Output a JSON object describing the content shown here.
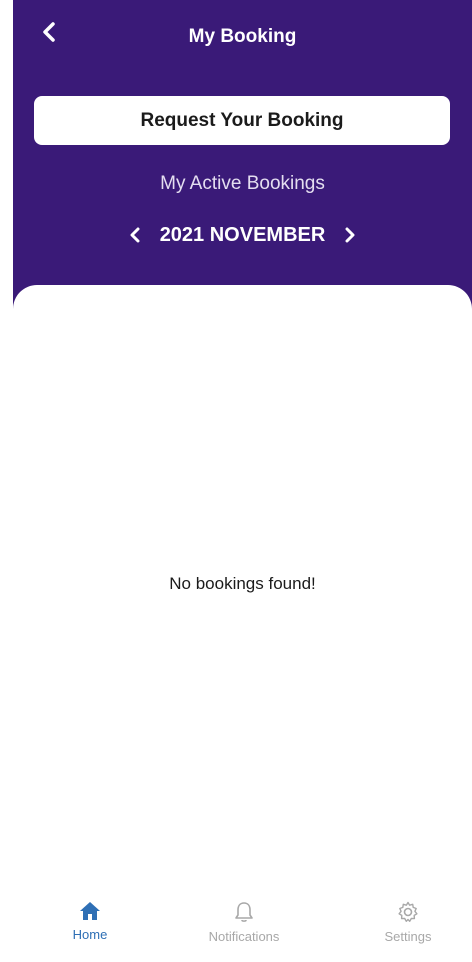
{
  "header": {
    "title": "My Booking",
    "back_icon": "chevron-left-icon",
    "request_button_label": "Request Your Booking",
    "active_bookings_label": "My Active Bookings",
    "month_label": "2021 NOVEMBER",
    "prev_month_icon": "chevron-left-icon",
    "next_month_icon": "chevron-right-icon"
  },
  "content": {
    "empty_message": "No bookings found!"
  },
  "bottom_nav": {
    "items": [
      {
        "label": "Home",
        "icon": "home-icon",
        "active": true
      },
      {
        "label": "Notifications",
        "icon": "bell-icon",
        "active": false
      },
      {
        "label": "Settings",
        "icon": "gear-icon",
        "active": false
      }
    ]
  },
  "colors": {
    "header_bg": "#3a1a78",
    "active_nav": "#2e6fb5",
    "inactive_nav": "#a8a8a8"
  }
}
